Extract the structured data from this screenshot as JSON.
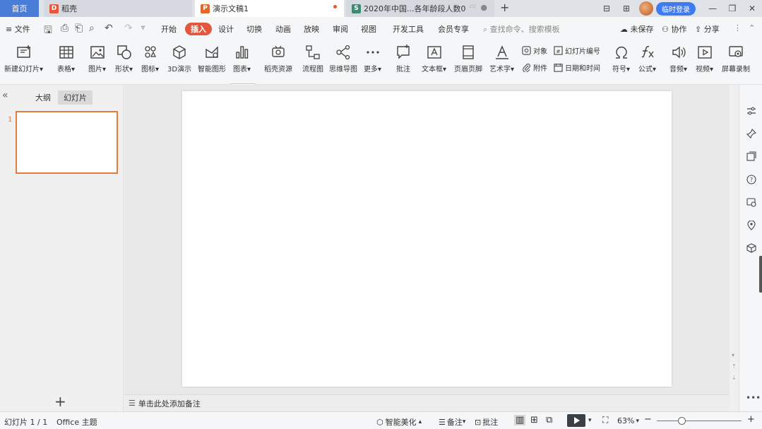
{
  "tabs": {
    "home": "首页",
    "daoke": "稻壳",
    "active": "演示文稿1",
    "xls": "2020年中国...各年龄段人数0"
  },
  "titlebar": {
    "login": "临时登录"
  },
  "menu": {
    "file": "文件",
    "items": [
      "开始",
      "插入",
      "设计",
      "切换",
      "动画",
      "放映",
      "审阅",
      "视图",
      "开发工具",
      "会员专享"
    ],
    "search": "查找命令、搜索模板",
    "unsaved": "未保存",
    "collab": "协作",
    "share": "分享"
  },
  "ribbon": {
    "new_slide": "新建幻灯片",
    "table": "表格",
    "picture": "图片",
    "shape": "形状",
    "icon": "图标",
    "three_d": "3D演示",
    "smart_graphic": "智能图形",
    "chart": "图表",
    "daoke_res": "稻壳资源",
    "flowchart": "流程图",
    "mindmap": "思维导图",
    "more": "更多",
    "comment": "批注",
    "textbox": "文本框",
    "header_footer": "页眉页脚",
    "wordart": "艺术字",
    "object": "对象",
    "slide_num": "幻灯片编号",
    "attachment": "附件",
    "datetime": "日期和时间",
    "symbol": "符号",
    "formula": "公式",
    "audio": "音频",
    "video": "视频",
    "screen_rec": "屏幕录制"
  },
  "left": {
    "outline": "大纲",
    "slides": "幻灯片",
    "slide_number": "1"
  },
  "notes": {
    "placeholder": "单击此处添加备注"
  },
  "status": {
    "slide_count": "幻灯片 1 / 1",
    "theme": "Office 主题",
    "beautify": "智能美化",
    "notes": "备注",
    "comment": "批注",
    "zoom": "63%"
  },
  "colors": {
    "accent": "#e2573e",
    "home_tab": "#4a7dd8",
    "login_btn": "#3f7bef",
    "thumb_border": "#e87a3e"
  }
}
